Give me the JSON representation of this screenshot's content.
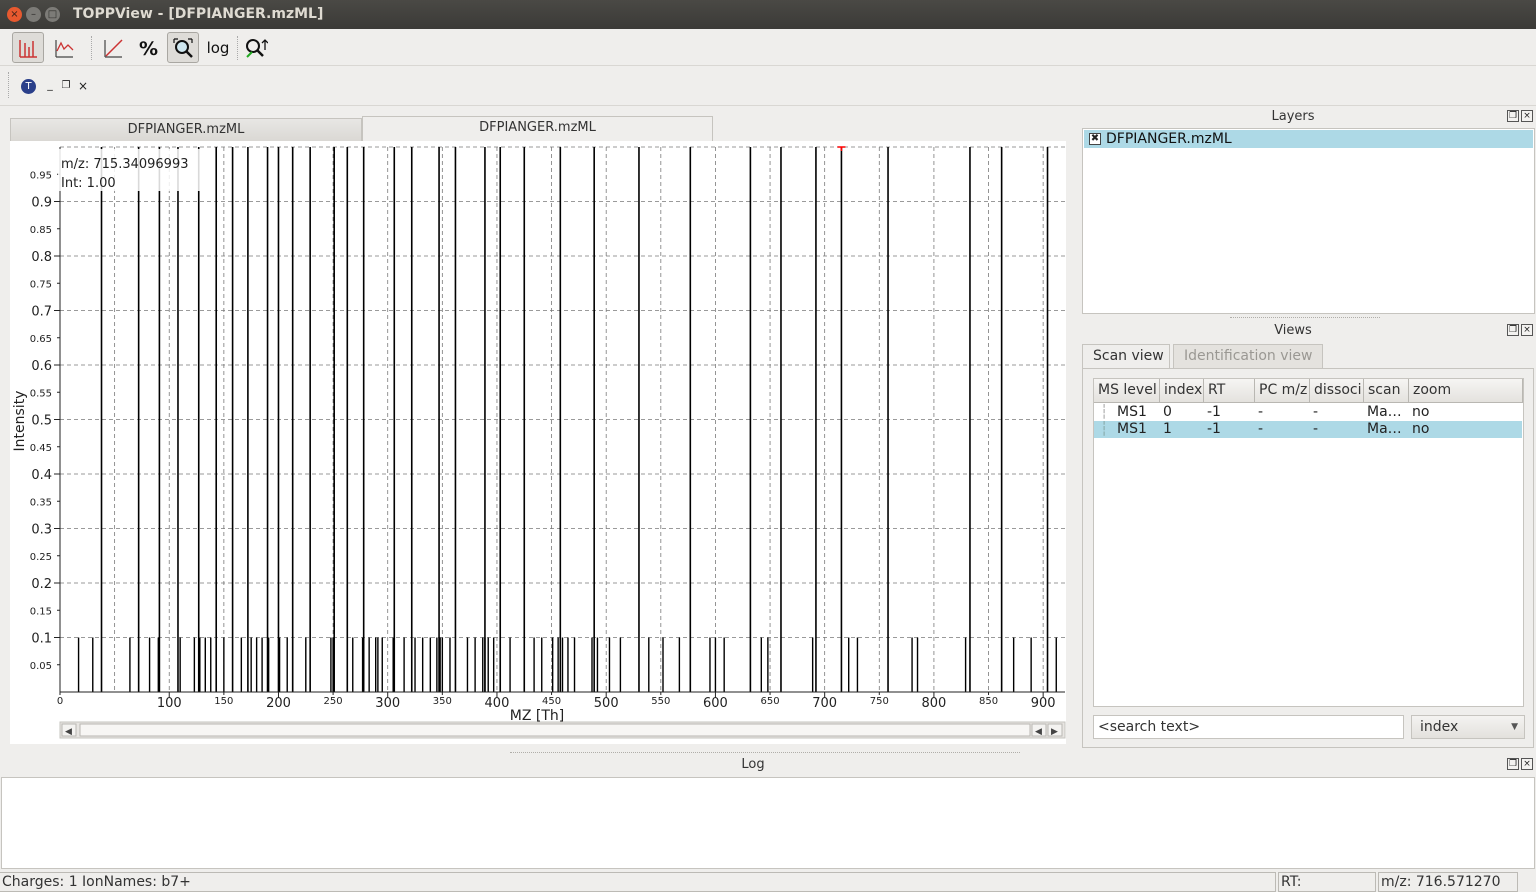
{
  "window": {
    "title": "TOPPView - [DFPIANGER.mzML]"
  },
  "toolbar": {
    "buttons": [
      "peak-mode",
      "line-mode",
      "linear-intensity",
      "percentage-intensity",
      "snap-intensity",
      "log-intensity",
      "ms-ms-scan"
    ],
    "log_label": "log"
  },
  "tabs": [
    {
      "label": "DFPIANGER.mzML"
    },
    {
      "label": "DFPIANGER.mzML"
    }
  ],
  "tooltip": {
    "mz_line": "m/z: 715.34096993",
    "int_line": "Int: 1.00"
  },
  "chart_data": {
    "type": "bar",
    "title": "",
    "xlabel": "MZ [Th]",
    "ylabel": "Intensity",
    "xlim": [
      0,
      920
    ],
    "ylim": [
      0,
      1.0
    ],
    "x_ticks_major": [
      "100",
      "200",
      "300",
      "400",
      "500",
      "600",
      "700",
      "800",
      "900"
    ],
    "x_ticks_minor": [
      "0",
      "150",
      "250",
      "350",
      "450",
      "550",
      "650",
      "750",
      "850"
    ],
    "y_ticks_major": [
      "0.1",
      "0.2",
      "0.3",
      "0.4",
      "0.5",
      "0.6",
      "0.7",
      "0.8",
      "0.9"
    ],
    "y_ticks_minor": [
      "0.05",
      "0.15",
      "0.25",
      "0.35",
      "0.45",
      "0.55",
      "0.65",
      "0.75",
      "0.85",
      "0.95"
    ],
    "grid": true,
    "tall_peaks": [
      {
        "mz": 38,
        "intensity": 1.0
      },
      {
        "mz": 72,
        "intensity": 1.0
      },
      {
        "mz": 91,
        "intensity": 1.0
      },
      {
        "mz": 108,
        "intensity": 1.0
      },
      {
        "mz": 127,
        "intensity": 1.0
      },
      {
        "mz": 143,
        "intensity": 1.0
      },
      {
        "mz": 158,
        "intensity": 1.0
      },
      {
        "mz": 172,
        "intensity": 1.0
      },
      {
        "mz": 190,
        "intensity": 1.0
      },
      {
        "mz": 200,
        "intensity": 1.0
      },
      {
        "mz": 213,
        "intensity": 1.0
      },
      {
        "mz": 229,
        "intensity": 1.0
      },
      {
        "mz": 251,
        "intensity": 1.0
      },
      {
        "mz": 263,
        "intensity": 1.0
      },
      {
        "mz": 278,
        "intensity": 1.0
      },
      {
        "mz": 306,
        "intensity": 1.0
      },
      {
        "mz": 322,
        "intensity": 1.0
      },
      {
        "mz": 347,
        "intensity": 1.0
      },
      {
        "mz": 362,
        "intensity": 1.0
      },
      {
        "mz": 389,
        "intensity": 1.0
      },
      {
        "mz": 403,
        "intensity": 1.0
      },
      {
        "mz": 425,
        "intensity": 1.0
      },
      {
        "mz": 458,
        "intensity": 1.0
      },
      {
        "mz": 489,
        "intensity": 1.0
      },
      {
        "mz": 530,
        "intensity": 1.0
      },
      {
        "mz": 577,
        "intensity": 1.0
      },
      {
        "mz": 632,
        "intensity": 1.0
      },
      {
        "mz": 660,
        "intensity": 1.0
      },
      {
        "mz": 692,
        "intensity": 1.0
      },
      {
        "mz": 715.34,
        "intensity": 1.0
      },
      {
        "mz": 758,
        "intensity": 1.0
      },
      {
        "mz": 833,
        "intensity": 1.0
      },
      {
        "mz": 862,
        "intensity": 1.0
      },
      {
        "mz": 904,
        "intensity": 1.0
      }
    ],
    "small_peaks_mz": [
      17,
      30,
      64,
      82,
      90,
      110,
      123,
      128,
      133,
      138,
      150,
      166,
      175,
      180,
      185,
      191,
      201,
      208,
      213,
      225,
      248,
      250,
      263,
      268,
      277,
      283,
      289,
      291,
      295,
      305,
      315,
      325,
      332,
      339,
      345,
      348,
      350,
      357,
      373,
      380,
      387,
      389,
      392,
      397,
      412,
      425,
      434,
      441,
      451,
      456,
      460,
      465,
      471,
      487,
      492,
      503,
      513,
      539,
      552,
      567,
      595,
      600,
      608,
      642,
      648,
      689,
      722,
      730,
      780,
      785,
      829,
      873,
      889,
      912
    ]
  },
  "layers": {
    "title": "Layers",
    "items": [
      {
        "name": "DFPIANGER.mzML",
        "checked": true
      }
    ]
  },
  "views": {
    "title": "Views",
    "tabs": [
      "Scan view",
      "Identification view"
    ],
    "columns": [
      "MS level",
      "index",
      "RT",
      "PC m/z",
      "dissoci",
      "scan",
      "zoom"
    ],
    "rows": [
      [
        "MS1",
        "0",
        "-1",
        "-",
        "-",
        "Ma…",
        "no"
      ],
      [
        "MS1",
        "1",
        "-1",
        "-",
        "-",
        "Ma…",
        "no"
      ]
    ],
    "search_placeholder": "<search text>",
    "search_by": "index"
  },
  "log": {
    "title": "Log"
  },
  "status": {
    "left": "Charges: 1 IonNames: b7+",
    "rt": "RT:",
    "mz": "m/z: 716.571270"
  },
  "colors": {
    "selection": "#add9e6",
    "peak": "#000000",
    "grid": "#7a7a7a",
    "cursor": "#ff0000"
  }
}
